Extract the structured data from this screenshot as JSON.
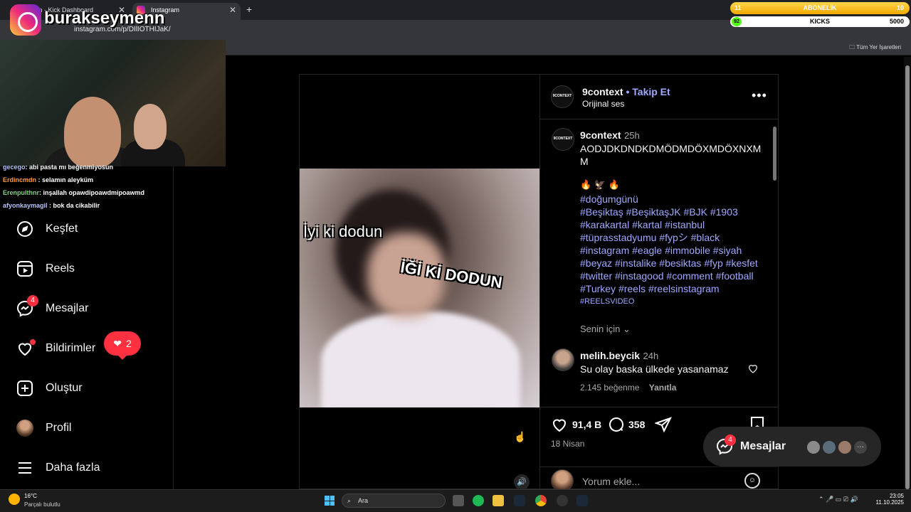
{
  "browser": {
    "tabs": [
      {
        "label": "m - Kick Dashboard"
      },
      {
        "label": "Instagram"
      }
    ],
    "url": "instagram.com/p/DIlIOTHIJaK/",
    "bookmarks_all": "Tüm Yer İşaretleri"
  },
  "overlay": {
    "handle": "burakseymenn",
    "subs_bar": {
      "left": "11",
      "label": "ABONELİK",
      "right": "10"
    },
    "kicks_bar": {
      "left": "92",
      "label": "KICKS",
      "right": "5000"
    },
    "chat": [
      {
        "user": "gecego",
        "text": ": abi pasta mı beğenmiyosun"
      },
      {
        "user": "Erdincmdn",
        "text": ": selamın aleyküm"
      },
      {
        "user": "Erenpulthnr",
        "text": ": inşallah opawdipoawdmipoawmd"
      },
      {
        "user": "afyonkaymagil",
        "text": ": bok da cikabilir"
      }
    ]
  },
  "sidebar": {
    "items": [
      {
        "label": "Keşfet",
        "icon": "compass-icon"
      },
      {
        "label": "Reels",
        "icon": "reels-icon"
      },
      {
        "label": "Mesajlar",
        "icon": "messenger-icon",
        "badge": "4"
      },
      {
        "label": "Bildirimler",
        "icon": "heart-icon"
      },
      {
        "label": "Oluştur",
        "icon": "plus-square-icon"
      },
      {
        "label": "Profil",
        "icon": "profile-avatar"
      },
      {
        "label": "Daha fazla",
        "icon": "menu-icon"
      }
    ],
    "notifications_pill": "2"
  },
  "post": {
    "video_captions": [
      "İyi ki dodun",
      "İĞİ Kİ DODUN"
    ],
    "author": "9context",
    "follow_label": "Takip Et",
    "audio": "Orijinal ses",
    "caption": {
      "author": "9context",
      "time": "25h",
      "text_line1": "AODJDKDNDKDMÖDMDÖXMDÖXNXM",
      "text_line2": "M",
      "emojis": "🔥 🦅 🔥",
      "hashtags": [
        "#doğumgünü",
        "#Beşiktaş #BeşiktaşJK #BJK #1903",
        "#karakartal #kartal #istanbul",
        "#tüprasstadyumu #fypシ #black",
        "#instagram #eagle #immobile #siyah",
        "#beyaz #instalike #besiktas #fyp #kesfet",
        "#twitter #instagood #comment #football",
        "#Turkey #reels #reelsinstagram",
        "#REELSVIDEO"
      ],
      "translation": "Senin için"
    },
    "comment": {
      "user": "melih.beycik",
      "time": "24h",
      "text": "Su olay baska ülkede yasanamaz",
      "likes": "2.145 beğenme",
      "reply": "Yanıtla"
    },
    "likes_count": "91,4 B",
    "comments_count": "358",
    "date": "18 Nisan",
    "comment_placeholder": "Yorum ekle..."
  },
  "messages_pill": {
    "label": "Mesajlar",
    "badge": "4",
    "more": "···"
  },
  "taskbar": {
    "temp": "16°C",
    "weather": "Parçalı bulutlu",
    "search": "Ara",
    "time": "23:05",
    "date": "11.10.2025"
  },
  "colors": {
    "accent_link": "#a0a8ff",
    "notification_red": "#ff3040",
    "kick_green": "#53fc18"
  }
}
